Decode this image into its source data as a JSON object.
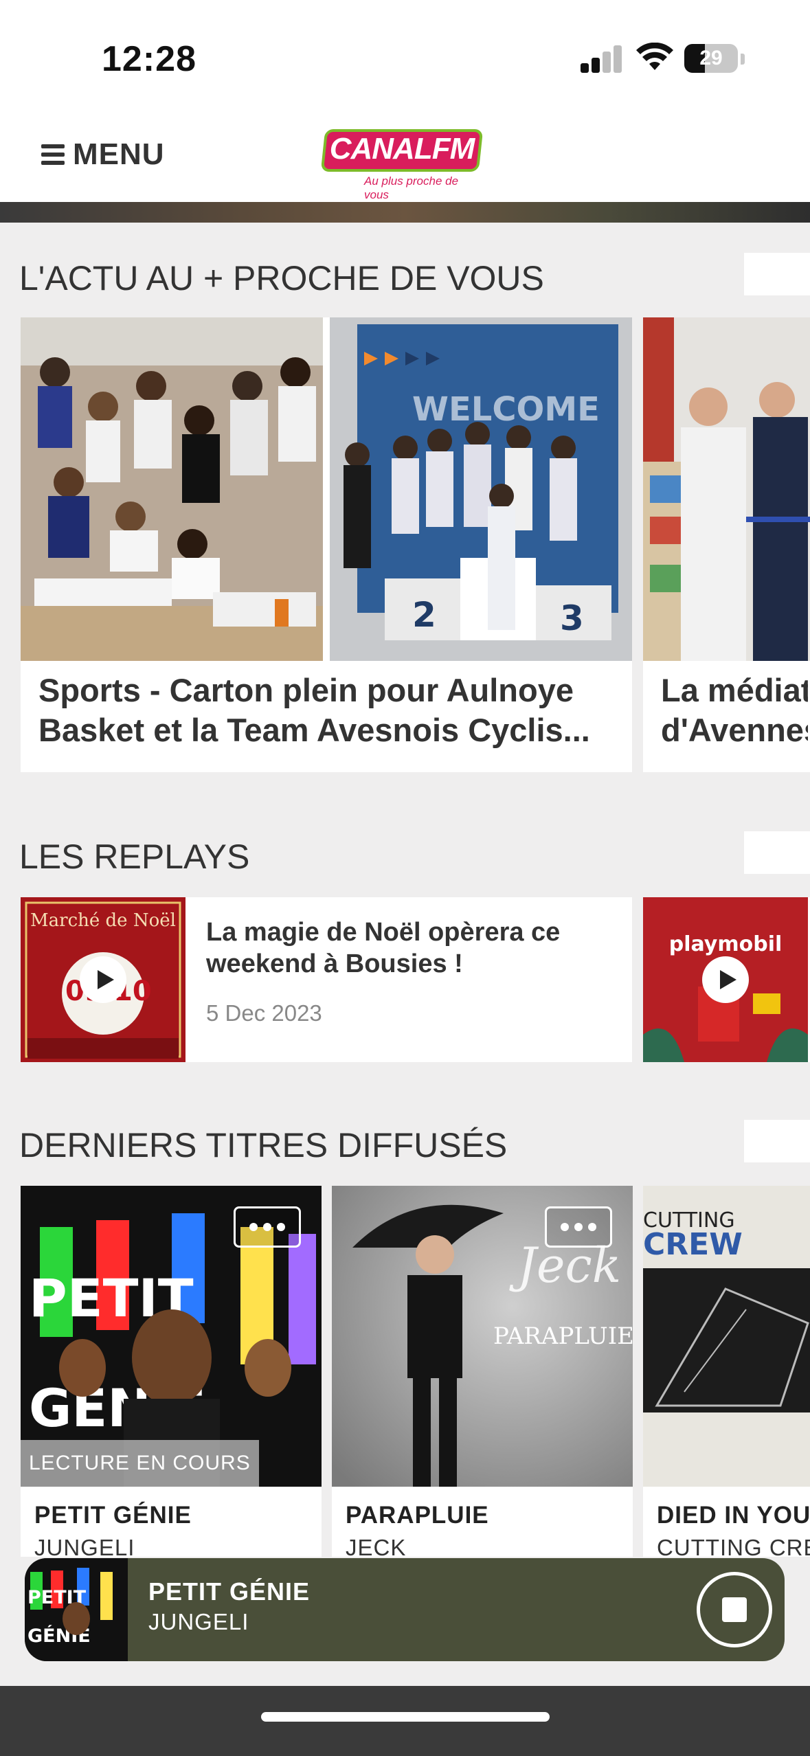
{
  "status_bar": {
    "time": "12:28",
    "battery": "29"
  },
  "header": {
    "menu_label": "MENU",
    "logo_text": "CANALFM",
    "logo_tagline": "Au plus proche de vous"
  },
  "sections": {
    "news": {
      "title": "L'ACTU AU + PROCHE DE VOUS",
      "items": [
        {
          "title_line1": "Sports - Carton plein pour Aulnoye",
          "title_line2": "Basket et la Team Avesnois Cyclis..."
        },
        {
          "title_line1": "La médiat",
          "title_line2": "d'Avennes"
        }
      ]
    },
    "replays": {
      "title": "LES REPLAYS",
      "items": [
        {
          "title": "La magie de Noël opèrera ce weekend à Bousies !",
          "date": "5 Dec 2023",
          "thumb_text": "Marché de Noël"
        },
        {
          "title": "",
          "date": "",
          "thumb_text": "playmobil"
        }
      ]
    },
    "tracks": {
      "title": "DERNIERS TITRES DIFFUSÉS",
      "now_playing_badge": "LECTURE EN COURS",
      "items": [
        {
          "title": "PETIT GÉNIE",
          "artist": "JUNGELI"
        },
        {
          "title": "PARAPLUIE",
          "artist": "JECK"
        },
        {
          "title": "DIED IN YOU",
          "artist": "CUTTING CRE"
        }
      ]
    }
  },
  "mini_player": {
    "title": "PETIT GÉNIE",
    "artist": "JUNGELI"
  },
  "colors": {
    "brand": "#d91d5c",
    "brand_accent": "#7dbb2a",
    "player_bg": "#4a4f39",
    "background": "#efeeee"
  }
}
